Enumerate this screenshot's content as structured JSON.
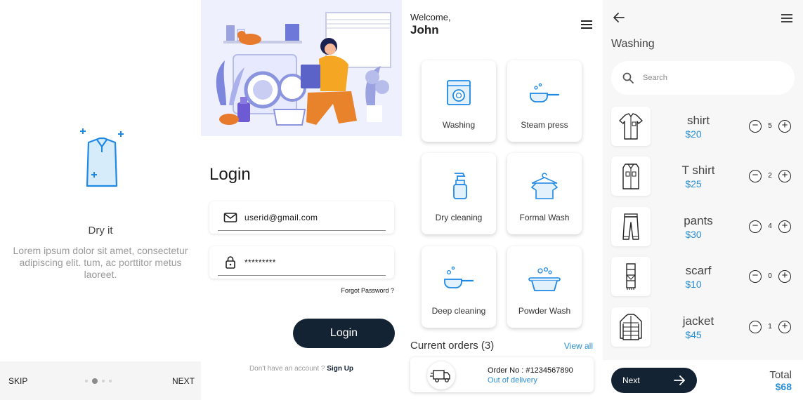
{
  "onboarding": {
    "title": "Dry it",
    "description": "Lorem ipsum dolor sit amet, consectetur adipiscing elit. tum, ac porttitor metus laoreet.",
    "skip_label": "SKIP",
    "next_label": "NEXT",
    "active_page": 2,
    "page_count": 4
  },
  "login": {
    "title": "Login",
    "email_value": "userid@gmail.com",
    "password_value": "*********",
    "forgot_label": "Forgot Password ?",
    "button_label": "Login",
    "no_account_text": "Don't have an account ?",
    "signup_label": "Sign Up"
  },
  "home": {
    "welcome_text": "Welcome,",
    "user_name": "John",
    "services": [
      {
        "label": "Washing",
        "icon": "washing-machine-icon"
      },
      {
        "label": "Steam press",
        "icon": "steam-iron-icon"
      },
      {
        "label": "Dry cleaning",
        "icon": "spray-bottle-icon"
      },
      {
        "label": "Formal Wash",
        "icon": "shirt-hanger-icon"
      },
      {
        "label": "Deep cleaning",
        "icon": "bubble-pan-icon"
      },
      {
        "label": "Powder Wash",
        "icon": "tub-icon"
      }
    ],
    "current_orders_label": "Current orders (3)",
    "view_all_label": "View all",
    "order": {
      "number_text": "Order No : #1234567890",
      "status": "Out of delivery"
    }
  },
  "cart": {
    "title": "Washing",
    "search_placeholder": "Search",
    "items": [
      {
        "name": "shirt",
        "price": "$20",
        "qty": "5",
        "icon": "shirt-icon"
      },
      {
        "name": "T shirt",
        "price": "$25",
        "qty": "2",
        "icon": "t-shirt-icon"
      },
      {
        "name": "pants",
        "price": "$30",
        "qty": "4",
        "icon": "pants-icon"
      },
      {
        "name": "scarf",
        "price": "$10",
        "qty": "0",
        "icon": "scarf-icon"
      },
      {
        "name": "jacket",
        "price": "$45",
        "qty": "1",
        "icon": "jacket-icon"
      }
    ],
    "next_label": "Next",
    "total_label": "Total",
    "total_value": "$68"
  },
  "colors": {
    "primary_dark": "#142333",
    "accent_blue": "#2a8fd6",
    "illustration_bg": "#eef0fd"
  }
}
